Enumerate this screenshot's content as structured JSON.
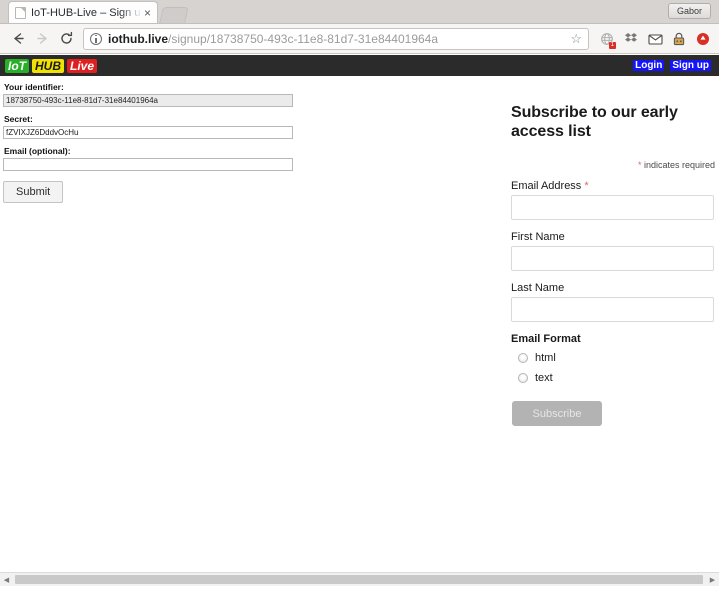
{
  "browser": {
    "tab": {
      "title": "IoT-HUB-Live – Sign u",
      "favicon_name": "page-icon",
      "close_label": "×"
    },
    "new_tab_label": "+",
    "profile_name": "Gabor",
    "nav": {
      "back_label": "Back",
      "forward_label": "Forward",
      "reload_label": "Reload"
    },
    "omnibox": {
      "security_label": "Site information",
      "host": "iothub.live",
      "path": "/signup/18738750-493c-11e8-81d7-31e84401964a",
      "full_url": "iothub.live/signup/18738750-493c-11e8-81d7-31e84401964a",
      "bookmark_label": "☆"
    },
    "extensions": [
      {
        "name": "globe-extension-icon",
        "glyph": "◌",
        "badge": "1"
      },
      {
        "name": "dropbox-extension-icon",
        "glyph": "⬥",
        "badge": ""
      },
      {
        "name": "mail-extension-icon",
        "glyph": "✉",
        "badge": ""
      },
      {
        "name": "lock-extension-icon",
        "glyph": "▣",
        "badge": ""
      },
      {
        "name": "record-extension-icon",
        "glyph": "⬤",
        "badge": ""
      }
    ]
  },
  "site": {
    "logo": {
      "part1": "IoT",
      "part2": "HUB",
      "part3": "Live"
    },
    "links": {
      "login": "Login",
      "signup": "Sign up"
    },
    "colors": {
      "logo_green": "#27b027",
      "logo_yellow": "#f2e200",
      "logo_red": "#e02020",
      "header_bg": "#2b2b2b",
      "link_bg": "#1414ff",
      "required_asterisk": "#e06666",
      "subscribe_button": "#b3b3b3"
    }
  },
  "signup_form": {
    "identifier": {
      "label": "Your identifier:",
      "value": "18738750-493c-11e8-81d7-31e84401964a",
      "placeholder": ""
    },
    "secret": {
      "label": "Secret:",
      "value": "fZVIXJZ6DddvOcHu",
      "placeholder": ""
    },
    "email": {
      "label": "Email (optional):",
      "value": "",
      "placeholder": ""
    },
    "submit_label": "Submit"
  },
  "subscribe_panel": {
    "title": "Subscribe to our early access list",
    "required_note_asterisk": "*",
    "required_note": " indicates required",
    "fields": [
      {
        "label": "Email Address",
        "required": true,
        "value": "",
        "placeholder": "",
        "name": "email-address"
      },
      {
        "label": "First Name",
        "required": false,
        "value": "",
        "placeholder": "",
        "name": "first-name"
      },
      {
        "label": "Last Name",
        "required": false,
        "value": "",
        "placeholder": "",
        "name": "last-name"
      }
    ],
    "format": {
      "title": "Email Format",
      "options": [
        {
          "label": "html",
          "selected": false
        },
        {
          "label": "text",
          "selected": false
        }
      ]
    },
    "submit_label": "Subscribe"
  },
  "scrollbar": {
    "left_arrow": "◀",
    "right_arrow": "▶"
  }
}
